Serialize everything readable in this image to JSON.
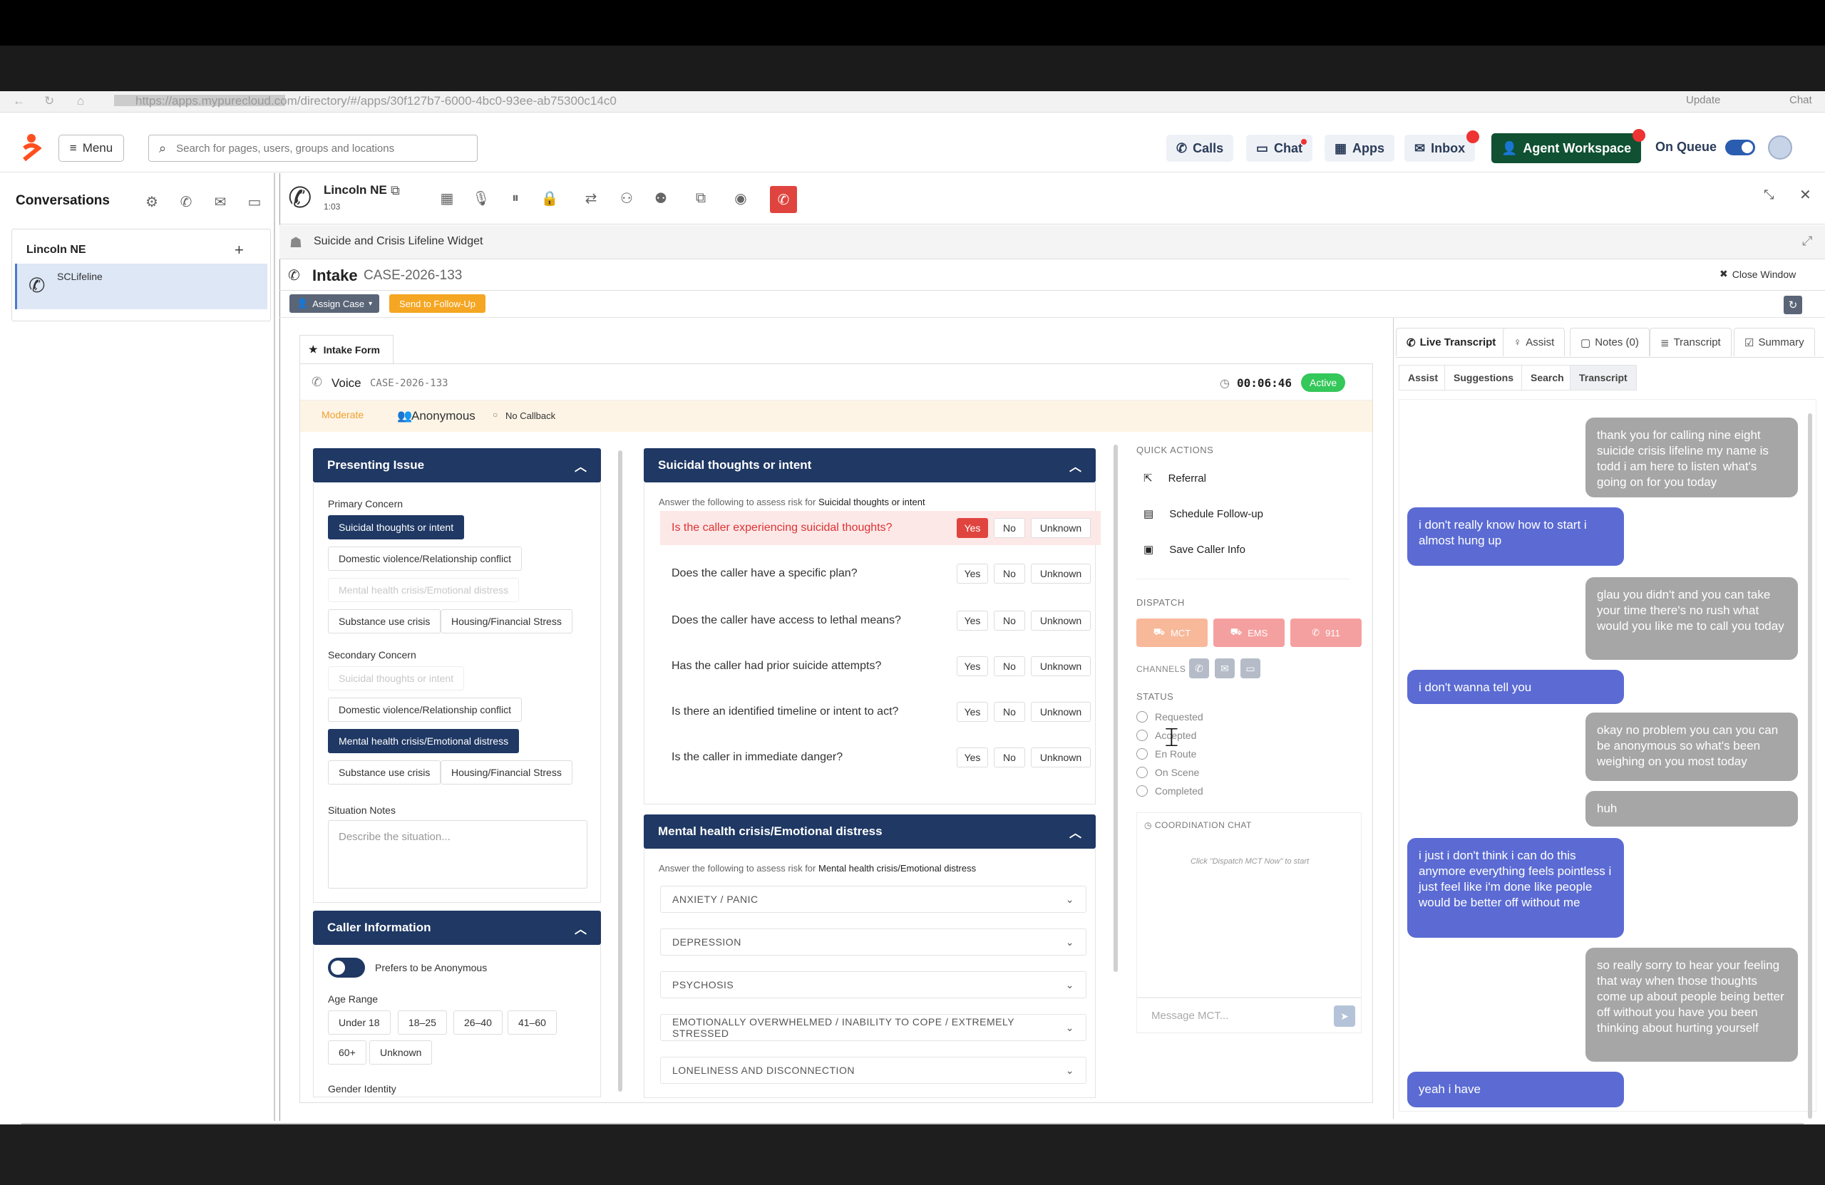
{
  "browser": {
    "url": "https://apps.mypurecloud.com/directory/#/apps/30f127b7-6000-4bc0-93ee-ab75300c14c0",
    "update_label": "Update",
    "chat_label": "Chat"
  },
  "header": {
    "menu_label": "Menu",
    "search_placeholder": "Search for pages, users, groups and locations",
    "calls": "Calls",
    "chat": "Chat",
    "apps": "Apps",
    "inbox": "Inbox",
    "agent_workspace": "Agent Workspace",
    "on_queue": "On Queue"
  },
  "sidebar": {
    "title": "Conversations",
    "group": "Lincoln NE",
    "item": "SCLifeline"
  },
  "call": {
    "name": "Lincoln NE",
    "timer": "1:03"
  },
  "widget": {
    "title": "Suicide and Crisis Lifeline Widget"
  },
  "intake": {
    "title": "Intake",
    "case_id": "CASE-2026-133",
    "close_window": "Close Window",
    "assign_case": "Assign Case",
    "send_follow_up": "Send to Follow-Up",
    "form_tab": "Intake Form",
    "voice": "Voice",
    "voice_case": "CASE-2026-133",
    "elapsed": "00:06:46",
    "status": "Active",
    "severity": "Moderate",
    "anonymous": "Anonymous",
    "callback": "No Callback"
  },
  "presenting": {
    "header": "Presenting Issue",
    "primary_label": "Primary Concern",
    "primary": [
      "Suicidal thoughts or intent",
      "Domestic violence/Relationship conflict",
      "Mental health crisis/Emotional distress",
      "Substance use crisis",
      "Housing/Financial Stress"
    ],
    "secondary_label": "Secondary Concern",
    "secondary": [
      "Suicidal thoughts or intent",
      "Domestic violence/Relationship conflict",
      "Mental health crisis/Emotional distress",
      "Substance use crisis",
      "Housing/Financial Stress"
    ],
    "notes_label": "Situation Notes",
    "notes_placeholder": "Describe the situation..."
  },
  "caller": {
    "header": "Caller Information",
    "anon_toggle": "Prefers to be Anonymous",
    "age_label": "Age Range",
    "ages": [
      "Under 18",
      "18–25",
      "26–40",
      "41–60",
      "60+",
      "Unknown"
    ],
    "gender_label": "Gender Identity"
  },
  "suicidal": {
    "header": "Suicidal thoughts or intent",
    "intro": "Answer the following to assess risk for",
    "intro_bold": "Suicidal thoughts or intent",
    "questions": [
      {
        "q": "Is the caller experiencing suicidal thoughts?",
        "answer": "Yes"
      },
      {
        "q": "Does the caller have a specific plan?",
        "answer": ""
      },
      {
        "q": "Does the caller have access to lethal means?",
        "answer": ""
      },
      {
        "q": "Has the caller had prior suicide attempts?",
        "answer": ""
      },
      {
        "q": "Is there an identified timeline or intent to act?",
        "answer": ""
      },
      {
        "q": "Is the caller in immediate danger?",
        "answer": ""
      }
    ],
    "yes": "Yes",
    "no": "No",
    "unknown": "Unknown"
  },
  "mental": {
    "header": "Mental health crisis/Emotional distress",
    "intro": "Answer the following to assess risk for",
    "intro_bold": "Mental health crisis/Emotional distress",
    "items": [
      "ANXIETY / PANIC",
      "DEPRESSION",
      "PSYCHOSIS",
      "EMOTIONALLY OVERWHELMED / INABILITY TO COPE / EXTREMELY STRESSED",
      "LONELINESS AND DISCONNECTION"
    ]
  },
  "actions": {
    "quick_label": "QUICK ACTIONS",
    "quick": [
      "Referral",
      "Schedule Follow-up",
      "Save Caller Info"
    ],
    "dispatch_label": "DISPATCH",
    "dispatch": [
      "MCT",
      "EMS",
      "911"
    ],
    "channels_label": "CHANNELS",
    "status_label": "STATUS",
    "statuses": [
      "Requested",
      "Accepted",
      "En Route",
      "On Scene",
      "Completed"
    ],
    "coord_label": "COORDINATION CHAT",
    "coord_hint": "Click \"Dispatch MCT Now\" to start",
    "message_placeholder": "Message MCT..."
  },
  "right": {
    "tabs": [
      "Live Transcript",
      "Assist",
      "Notes (0)",
      "Transcript",
      "Summary"
    ],
    "subtabs": [
      "Assist",
      "Suggestions",
      "Search",
      "Transcript"
    ],
    "messages": [
      {
        "side": "r",
        "text": "thank you for calling nine eight suicide crisis lifeline my name is todd i am here to listen what's going on for you today"
      },
      {
        "side": "l",
        "text": "i don't really know how to start i almost hung up"
      },
      {
        "side": "r",
        "text": "glau you didn't and you can take your time there's no rush what would you like me to call you today"
      },
      {
        "side": "l",
        "text": "i don't wanna tell you"
      },
      {
        "side": "r",
        "text": "okay no problem you can you can be anonymous so what's been weighing on you most today"
      },
      {
        "side": "r",
        "text": "huh"
      },
      {
        "side": "l",
        "text": "i just i don't think i can do this anymore everything feels pointless i just feel like i'm done like people would be better off without me"
      },
      {
        "side": "r",
        "text": "so really sorry to hear your feeling that way when those thoughts come up about people being better off without you have you been thinking about hurting yourself"
      },
      {
        "side": "l",
        "text": "yeah i have"
      }
    ]
  }
}
